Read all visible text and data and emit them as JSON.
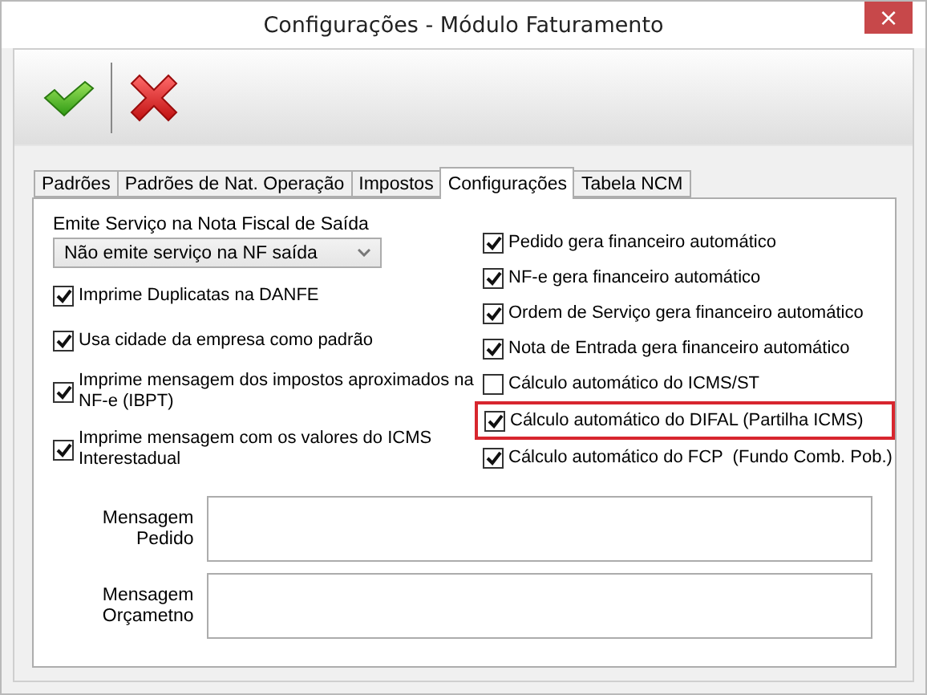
{
  "window": {
    "title": "Configurações - Módulo Faturamento",
    "close": "×"
  },
  "tabs": [
    {
      "label": "Padrões",
      "selected": false
    },
    {
      "label": "Padrões de Nat. Operação",
      "selected": false
    },
    {
      "label": "Impostos",
      "selected": false
    },
    {
      "label": "Configurações",
      "selected": true
    },
    {
      "label": "Tabela NCM",
      "selected": false
    }
  ],
  "service_select": {
    "label": "Emite Serviço na Nota Fiscal de Saída",
    "value": "Não emite serviço na NF saída"
  },
  "left_options": [
    {
      "label": "Imprime Duplicatas na DANFE",
      "checked": true
    },
    {
      "label": "Usa cidade da empresa como padrão",
      "checked": true
    },
    {
      "label": "Imprime mensagem dos impostos aproximados na NF-e (IBPT)",
      "checked": true
    },
    {
      "label": "Imprime mensagem com os valores do ICMS Interestadual",
      "checked": true
    }
  ],
  "right_options": [
    {
      "label": "Pedido gera financeiro automático",
      "checked": true,
      "highlighted": false
    },
    {
      "label": "NF-e gera financeiro automático",
      "checked": true,
      "highlighted": false
    },
    {
      "label": "Ordem de Serviço gera financeiro automático",
      "checked": true,
      "highlighted": false
    },
    {
      "label": "Nota de Entrada gera financeiro automático",
      "checked": true,
      "highlighted": false
    },
    {
      "label": "Cálculo automático do ICMS/ST",
      "checked": false,
      "highlighted": false
    },
    {
      "label": "Cálculo automático do DIFAL (Partilha ICMS)",
      "checked": true,
      "highlighted": true
    },
    {
      "label": "Cálculo automático do FCP  (Fundo Comb. Pob.)",
      "checked": true,
      "highlighted": false
    }
  ],
  "messages": [
    {
      "label": "Mensagem Pedido"
    },
    {
      "label": "Mensagem Orçametno"
    }
  ]
}
